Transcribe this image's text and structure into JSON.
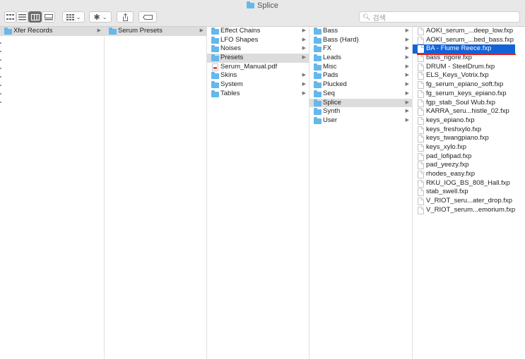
{
  "window": {
    "title": "Splice"
  },
  "search": {
    "placeholder": "검색"
  },
  "toolbar": {
    "dropdown_arrow": "⌄"
  },
  "columns": [
    {
      "items": [
        {
          "label": "Xfer Records",
          "type": "folder",
          "state": "selected",
          "has_children": true
        }
      ]
    },
    {
      "items": [
        {
          "label": "Serum Presets",
          "type": "folder",
          "state": "selected",
          "has_children": true
        }
      ]
    },
    {
      "items": [
        {
          "label": "Effect Chains",
          "type": "folder",
          "has_children": true
        },
        {
          "label": "LFO Shapes",
          "type": "folder",
          "has_children": true
        },
        {
          "label": "Noises",
          "type": "folder",
          "has_children": true
        },
        {
          "label": "Presets",
          "type": "folder",
          "state": "selected",
          "has_children": true
        },
        {
          "label": "Serum_Manual.pdf",
          "type": "pdf"
        },
        {
          "label": "Skins",
          "type": "folder",
          "has_children": true
        },
        {
          "label": "System",
          "type": "folder",
          "has_children": true
        },
        {
          "label": "Tables",
          "type": "folder",
          "has_children": true
        }
      ]
    },
    {
      "items": [
        {
          "label": "Bass",
          "type": "folder",
          "has_children": true
        },
        {
          "label": "Bass (Hard)",
          "type": "folder",
          "has_children": true
        },
        {
          "label": "FX",
          "type": "folder",
          "has_children": true
        },
        {
          "label": "Leads",
          "type": "folder",
          "has_children": true
        },
        {
          "label": "Misc",
          "type": "folder",
          "has_children": true
        },
        {
          "label": "Pads",
          "type": "folder",
          "has_children": true
        },
        {
          "label": "Plucked",
          "type": "folder",
          "has_children": true
        },
        {
          "label": "Seq",
          "type": "folder",
          "has_children": true
        },
        {
          "label": "Splice",
          "type": "folder",
          "state": "selected",
          "has_children": true
        },
        {
          "label": "Synth",
          "type": "folder",
          "has_children": true
        },
        {
          "label": "User",
          "type": "folder",
          "has_children": true
        }
      ]
    },
    {
      "items": [
        {
          "label": "AOKI_serum_...deep_low.fxp",
          "type": "file"
        },
        {
          "label": "AOKI_serum_...bed_bass.fxp",
          "type": "file"
        },
        {
          "label": "BA - Flume Reece.fxp",
          "type": "file",
          "state": "active"
        },
        {
          "label": "bass_rigore.fxp",
          "type": "file"
        },
        {
          "label": "DRUM - SteelDrum.fxp",
          "type": "file"
        },
        {
          "label": "ELS_Keys_Votrix.fxp",
          "type": "file"
        },
        {
          "label": "fg_serum_epiano_soft.fxp",
          "type": "file"
        },
        {
          "label": "fg_serum_keys_epiano.fxp",
          "type": "file"
        },
        {
          "label": "fgp_stab_Soul Wub.fxp",
          "type": "file"
        },
        {
          "label": "KARRA_seru...histle_02.fxp",
          "type": "file"
        },
        {
          "label": "keys_epiano.fxp",
          "type": "file"
        },
        {
          "label": "keys_freshxylo.fxp",
          "type": "file"
        },
        {
          "label": "keys_twangpiano.fxp",
          "type": "file"
        },
        {
          "label": "keys_xylo.fxp",
          "type": "file"
        },
        {
          "label": "pad_lofipad.fxp",
          "type": "file"
        },
        {
          "label": "pad_yeezy.fxp",
          "type": "file"
        },
        {
          "label": "rhodes_easy.fxp",
          "type": "file"
        },
        {
          "label": "RKU_IOG_BS_808_Hall.fxp",
          "type": "file"
        },
        {
          "label": "stab_swell.fxp",
          "type": "file"
        },
        {
          "label": "V_RIOT_seru...ater_drop.fxp",
          "type": "file"
        },
        {
          "label": "V_RIOT_serum...emorium.fxp",
          "type": "file"
        }
      ]
    }
  ],
  "icons": {
    "folder": "folder-icon",
    "file": "file-icon",
    "pdf": "pdf-file-icon",
    "chevron": "chevron-right-icon"
  },
  "colors": {
    "selection_gray": "#dcdcdc",
    "selection_blue": "#1363d7",
    "folder_blue": "#64b8ec",
    "annotation_red": "#e02020"
  }
}
